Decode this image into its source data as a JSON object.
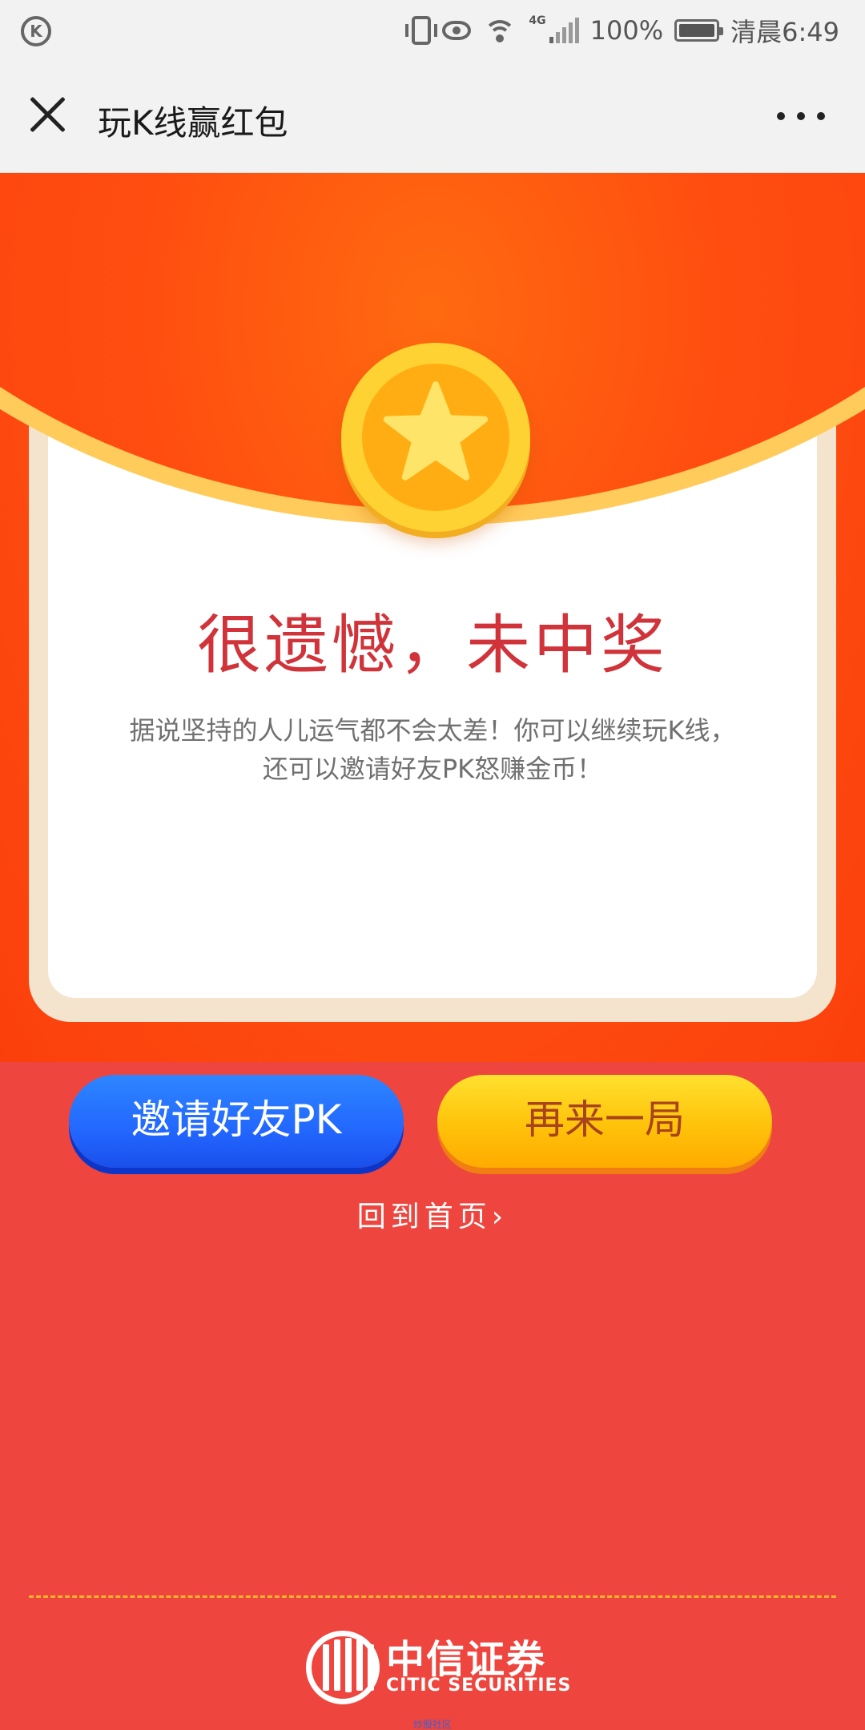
{
  "status_bar": {
    "battery": "100%",
    "network": "4G",
    "time": "清晨6:49",
    "icons": [
      "app-k-icon",
      "vibrate-icon",
      "eye-icon",
      "wifi-icon",
      "signal-icon",
      "battery-icon"
    ]
  },
  "title_bar": {
    "title": "玩K线赢红包",
    "close_icon": "close-icon",
    "more_icon": "more-icon"
  },
  "result": {
    "title": "很遗憾，未中奖",
    "desc_line1": "据说坚持的人儿运气都不会太差！你可以继续玩K线，",
    "desc_line2": "还可以邀请好友PK怒赚金币！",
    "coin_icon": "star-coin-icon"
  },
  "actions": {
    "invite_label": "邀请好友PK",
    "again_label": "再来一局",
    "home_label": "回到首页",
    "home_chevron": "›"
  },
  "footer": {
    "logo_cn": "中信证券",
    "logo_en": "CITIC SECURITIES",
    "note": "炒股社区"
  },
  "colors": {
    "page_bg": "#ee453e",
    "banner_orange": "#ff5513",
    "title_red": "#d0343a",
    "invite_blue": "#2267ff",
    "again_yellow": "#ffc20a",
    "again_text": "#a7441b",
    "divider_gold": "#f8b32c"
  }
}
